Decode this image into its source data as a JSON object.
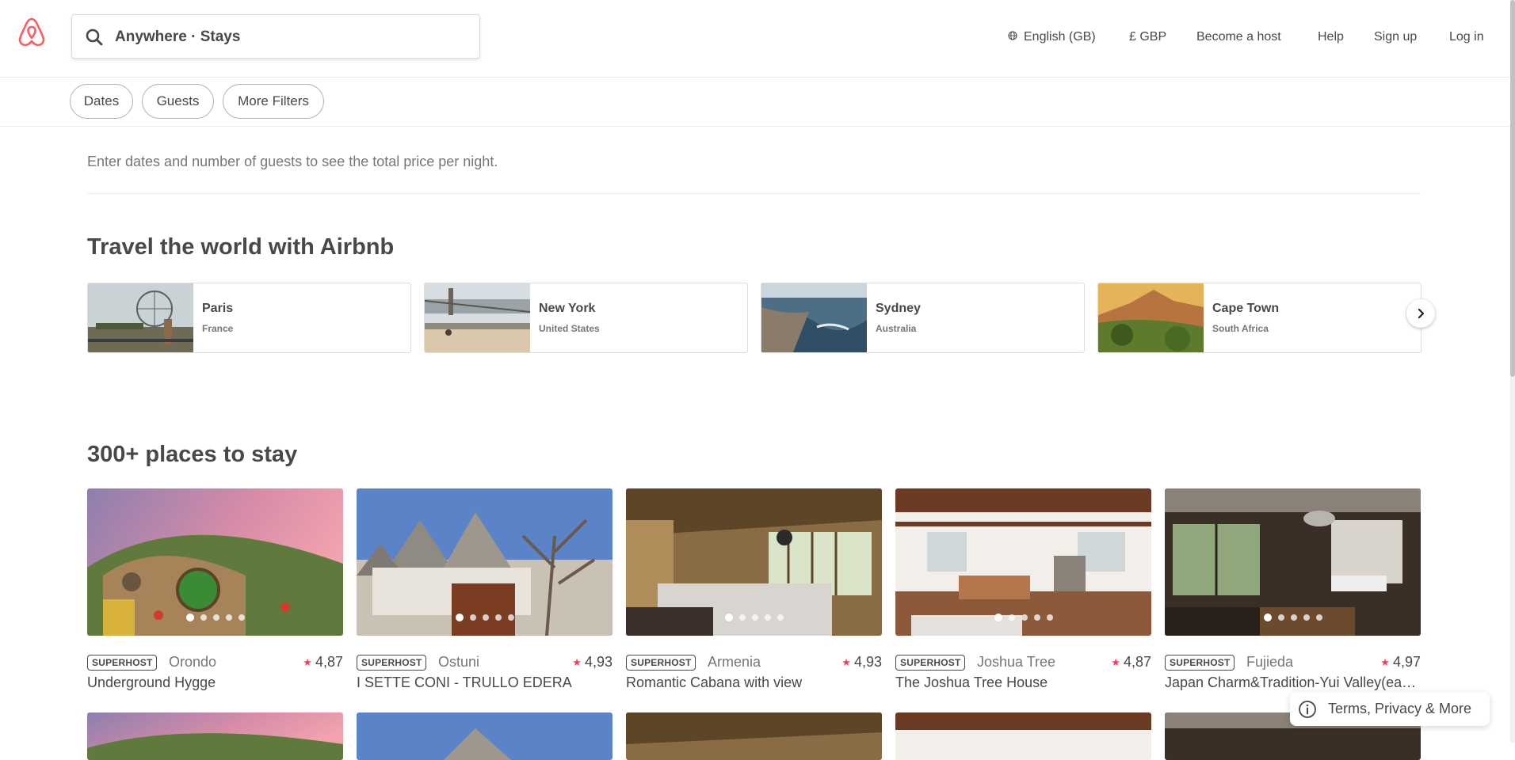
{
  "header": {
    "search_text": "Anywhere · Stays",
    "nav": {
      "language": "English (GB)",
      "currency": "£ GBP",
      "become_host": "Become a host",
      "help": "Help",
      "sign_up": "Sign up",
      "log_in": "Log in"
    }
  },
  "filters": [
    "Dates",
    "Guests",
    "More Filters"
  ],
  "notice": "Enter dates and number of guests to see the total price per night.",
  "travel": {
    "title": "Travel the world with Airbnb",
    "destinations": [
      {
        "city": "Paris",
        "country": "France"
      },
      {
        "city": "New York",
        "country": "United States"
      },
      {
        "city": "Sydney",
        "country": "Australia"
      },
      {
        "city": "Cape Town",
        "country": "South Africa"
      }
    ]
  },
  "places": {
    "title": "300+ places to stay",
    "listings": [
      {
        "badge": "SUPERHOST",
        "location": "Orondo",
        "rating": "4,87",
        "name": "Underground Hygge"
      },
      {
        "badge": "SUPERHOST",
        "location": "Ostuni",
        "rating": "4,93",
        "name": "I SETTE CONI - TRULLO EDERA"
      },
      {
        "badge": "SUPERHOST",
        "location": "Armenia",
        "rating": "4,93",
        "name": "Romantic Cabana with view"
      },
      {
        "badge": "SUPERHOST",
        "location": "Joshua Tree",
        "rating": "4,87",
        "name": "The Joshua Tree House"
      },
      {
        "badge": "SUPERHOST",
        "location": "Fujieda",
        "rating": "4,97",
        "name": "Japan Charm&Tradition-Yui Valley(easy ..."
      }
    ]
  },
  "footer": {
    "terms": "Terms, Privacy & More"
  },
  "colors": {
    "brand": "#ff5a5f",
    "star": "#ff385c",
    "text": "#484848",
    "muted": "#767676"
  },
  "icons": [
    "airbnb-logo",
    "search-icon",
    "globe-icon",
    "chevron-right-icon",
    "star-icon",
    "info-icon"
  ]
}
